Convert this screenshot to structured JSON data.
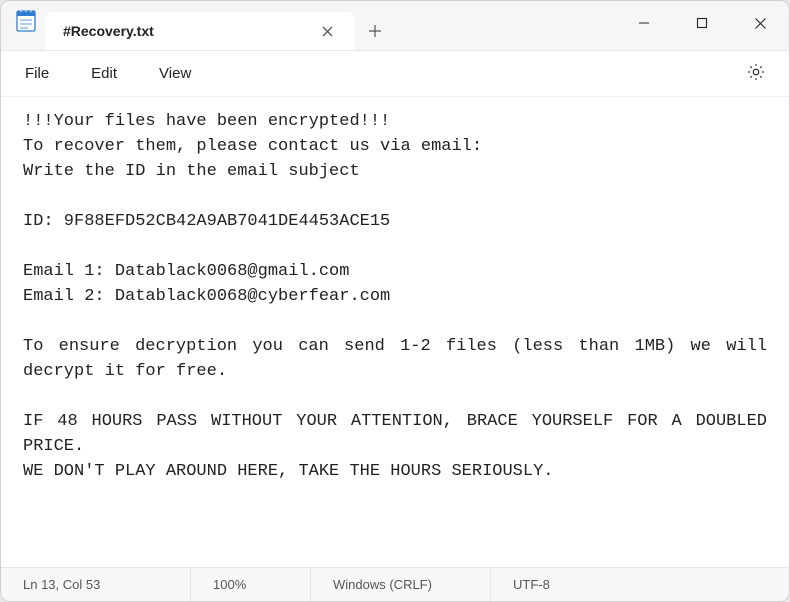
{
  "window": {
    "tab_title": "#Recovery.txt"
  },
  "menu": {
    "file": "File",
    "edit": "Edit",
    "view": "View"
  },
  "document": {
    "body": "!!!Your files have been encrypted!!!\nTo recover them, please contact us via email:\nWrite the ID in the email subject\n\nID: 9F88EFD52CB42A9AB7041DE4453ACE15\n\nEmail 1: Datablack0068@gmail.com\nEmail 2: Datablack0068@cyberfear.com\n\nTo ensure decryption you can send 1-2 files (less than 1MB) we will decrypt it for free.\n\nIF 48 HOURS PASS WITHOUT YOUR ATTENTION, BRACE YOURSELF FOR A DOUBLED PRICE.\nWE DON'T PLAY AROUND HERE, TAKE THE HOURS SERIOUSLY."
  },
  "status": {
    "position": "Ln 13, Col 53",
    "zoom": "100%",
    "line_ending": "Windows (CRLF)",
    "encoding": "UTF-8"
  }
}
